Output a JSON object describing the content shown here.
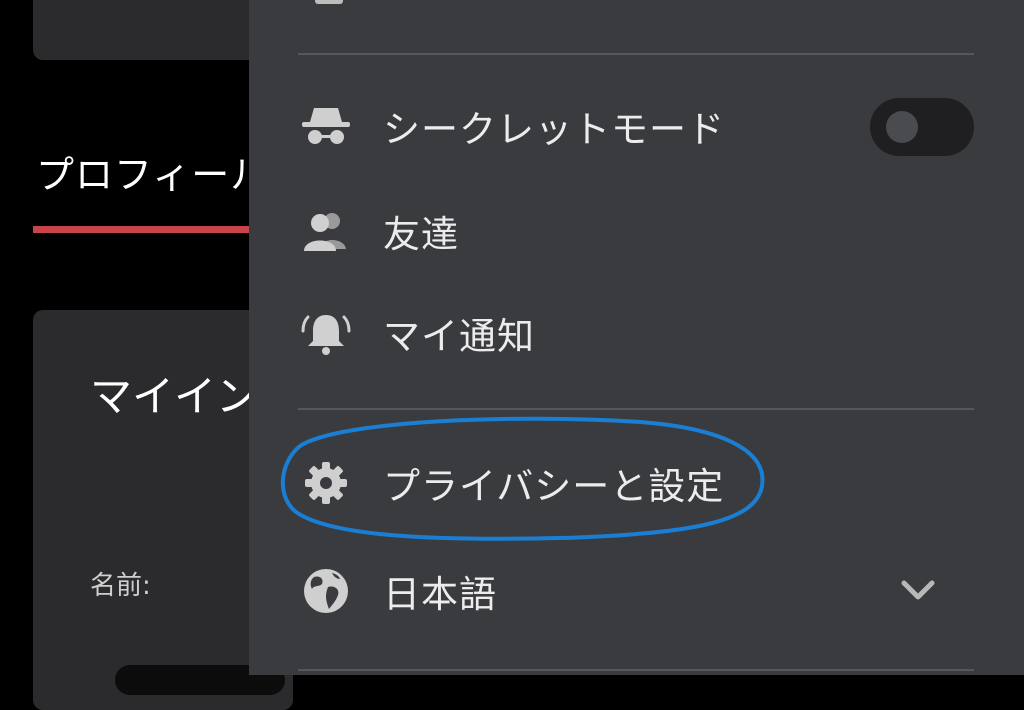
{
  "background": {
    "tab_label": "プロフィール",
    "card_title": "マイイン",
    "name_label": "名前:"
  },
  "menu": {
    "items": [
      {
        "label": "シークレットモード",
        "icon": "incognito-icon",
        "toggle_on": false
      },
      {
        "label": "友達",
        "icon": "friends-icon"
      },
      {
        "label": "マイ通知",
        "icon": "bell-icon"
      },
      {
        "label": "プライバシーと設定",
        "icon": "gear-icon"
      },
      {
        "label": "日本語",
        "icon": "globe-icon"
      }
    ]
  },
  "colors": {
    "drawer_bg": "#3a3b3e",
    "accent_underline": "#c8444a",
    "annotation_circle": "#1a7fd4"
  }
}
